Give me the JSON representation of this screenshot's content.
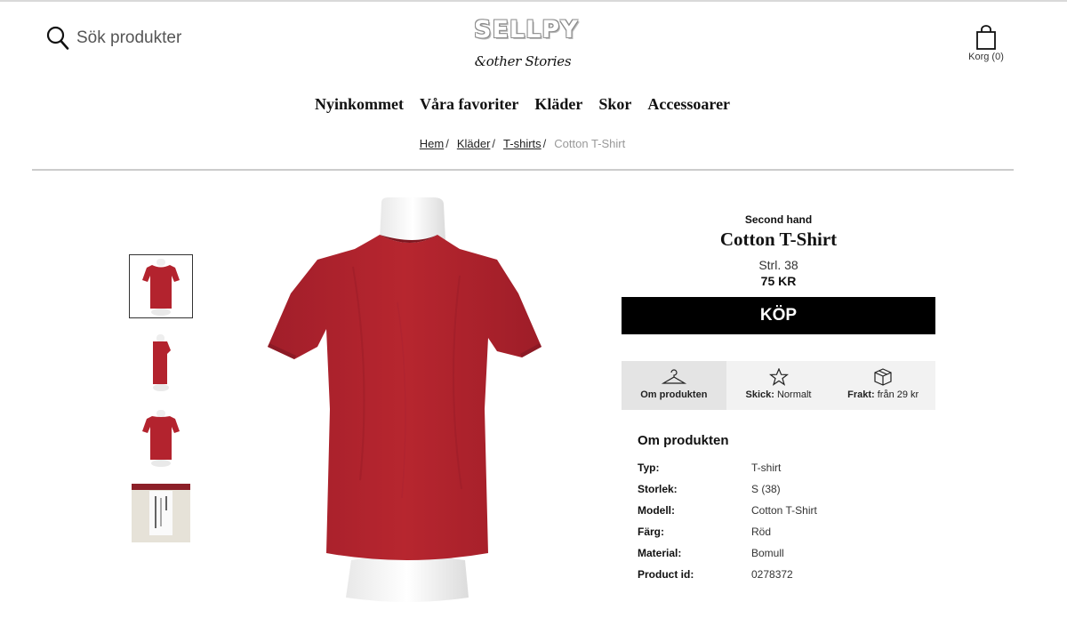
{
  "header": {
    "search": {
      "placeholder": "Sök produkter",
      "icon": "search-icon"
    },
    "logo": {
      "main": "SELLPY",
      "sub": "&other Stories"
    },
    "cart": {
      "label": "Korg (0)",
      "icon": "shopping-bag-icon"
    }
  },
  "nav": {
    "items": [
      "Nyinkommet",
      "Våra favoriter",
      "Kläder",
      "Skor",
      "Accessoarer"
    ]
  },
  "breadcrumb": {
    "links": [
      "Hem",
      "Kläder",
      "T-shirts"
    ],
    "separator": "/",
    "current": "Cotton T-Shirt"
  },
  "product": {
    "condition": "Second hand",
    "title": "Cotton T-Shirt",
    "size": "Strl. 38",
    "price": "75 KR",
    "buy_label": "KÖP",
    "color": "#b3232e",
    "thumbnails": [
      "front",
      "side",
      "back",
      "label"
    ]
  },
  "tabs": [
    {
      "icon": "hanger-icon",
      "label": "Om produkten",
      "value": ""
    },
    {
      "icon": "star-icon",
      "label": "Skick:",
      "value": "Normalt"
    },
    {
      "icon": "box-icon",
      "label": "Frakt:",
      "value": "från 29 kr"
    }
  ],
  "details": {
    "title": "Om produkten",
    "rows": [
      {
        "key": "Typ:",
        "value": "T-shirt"
      },
      {
        "key": "Storlek:",
        "value": "S (38)"
      },
      {
        "key": "Modell:",
        "value": "Cotton T-Shirt"
      },
      {
        "key": "Färg:",
        "value": "Röd"
      },
      {
        "key": "Material:",
        "value": "Bomull"
      },
      {
        "key": "Product id:",
        "value": "0278372"
      }
    ]
  }
}
